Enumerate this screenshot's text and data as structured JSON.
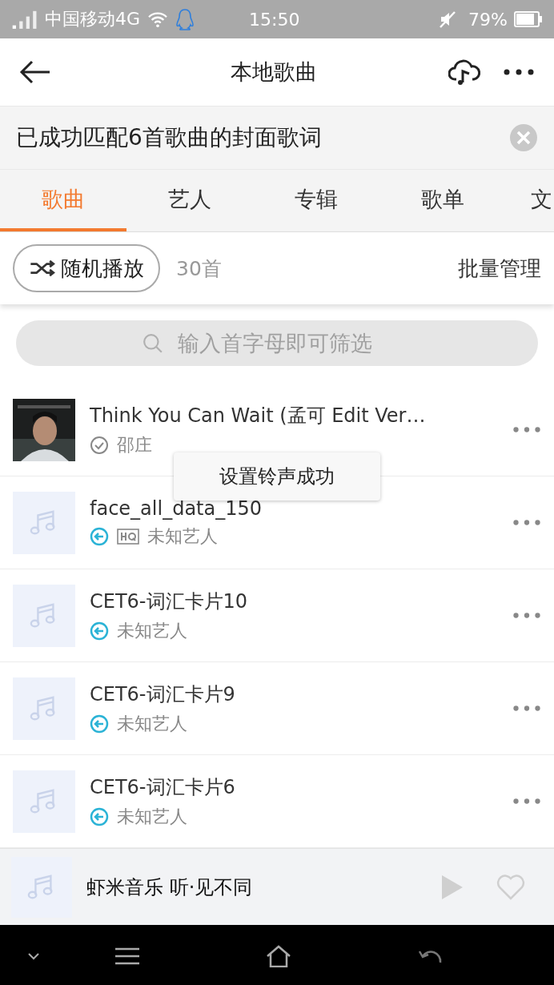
{
  "status_bar": {
    "carrier": "中国移动4G",
    "time": "15:50",
    "battery": "79%"
  },
  "header": {
    "title": "本地歌曲"
  },
  "banner": {
    "text": "已成功匹配6首歌曲的封面歌词"
  },
  "tabs": [
    {
      "label": "歌曲",
      "selected": true
    },
    {
      "label": "艺人",
      "selected": false
    },
    {
      "label": "专辑",
      "selected": false
    },
    {
      "label": "歌单",
      "selected": false
    },
    {
      "label": "文",
      "selected": false
    }
  ],
  "actions": {
    "shuffle": "随机播放",
    "count": "30首",
    "manage": "批量管理"
  },
  "search": {
    "placeholder": "输入首字母即可筛选"
  },
  "songs": [
    {
      "title": "Think You Can Wait (孟可 Edit Ver…",
      "artist": "邵庄",
      "kind": "matched",
      "hq": false
    },
    {
      "title": "face_all_data_150",
      "artist": "未知艺人",
      "art": {
        "kind": "placeholder"
      },
      "kind": "local",
      "hq": true
    },
    {
      "title": "CET6-词汇卡片10",
      "artist": "未知艺人",
      "art": {
        "kind": "placeholder"
      },
      "kind": "local",
      "hq": false
    },
    {
      "title": "CET6-词汇卡片9",
      "artist": "未知艺人",
      "art": {
        "kind": "placeholder"
      },
      "kind": "local",
      "hq": false
    },
    {
      "title": "CET6-词汇卡片6",
      "artist": "未知艺人",
      "art": {
        "kind": "placeholder"
      },
      "kind": "local",
      "hq": false
    }
  ],
  "toast": {
    "text": "设置铃声成功"
  },
  "player": {
    "title": "虾米音乐 听·见不同"
  }
}
